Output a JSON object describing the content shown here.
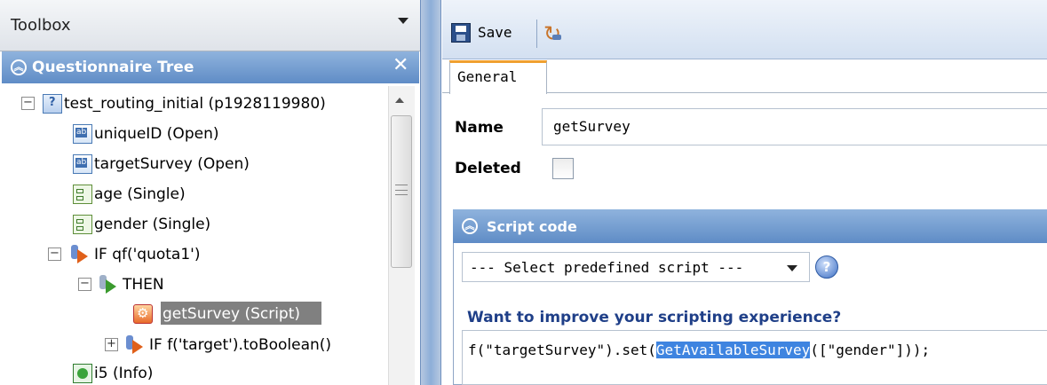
{
  "toolbox": {
    "title": "Toolbox"
  },
  "questionnaire_tree": {
    "title": "Questionnaire Tree",
    "close_glyph": "✕",
    "nodes": [
      {
        "label": "test_routing_initial (p1928119980)",
        "icon": "survey-icon",
        "expander": "−"
      },
      {
        "label": "uniqueID (Open)",
        "icon": "open-question-icon"
      },
      {
        "label": "targetSurvey (Open)",
        "icon": "open-question-icon"
      },
      {
        "label": "age (Single)",
        "icon": "single-question-icon"
      },
      {
        "label": "gender (Single)",
        "icon": "single-question-icon"
      },
      {
        "label": "IF qf('quota1')",
        "icon": "if-icon",
        "expander": "−"
      },
      {
        "label": "THEN",
        "icon": "then-icon",
        "expander": "−"
      },
      {
        "label": "getSurvey (Script)",
        "icon": "script-icon",
        "selected": true
      },
      {
        "label": "IF f('target').toBoolean()",
        "icon": "if-icon",
        "expander": "+"
      },
      {
        "label": "i5 (Info)",
        "icon": "info-icon"
      }
    ]
  },
  "editor": {
    "toolbar": {
      "save_label": "Save"
    },
    "tabs": [
      {
        "label": "General",
        "active": true
      }
    ],
    "fields": {
      "name_label": "Name",
      "name_value": "getSurvey",
      "deleted_label": "Deleted",
      "deleted_checked": false
    },
    "script": {
      "title": "Script code",
      "predefined_select": "--- Select predefined script ---",
      "improve_link": "Want to improve your scripting experience?",
      "code_before": "f(\"targetSurvey\").set(",
      "code_selected": "GetAvailableSurvey",
      "code_after": "([\"gender\"]));"
    }
  },
  "colors": {
    "panel_header": "#5f8cc6",
    "selection": "#808080",
    "tab_accent": "#f0a030",
    "link": "#1f3f88",
    "code_highlight": "#3e84e0"
  }
}
